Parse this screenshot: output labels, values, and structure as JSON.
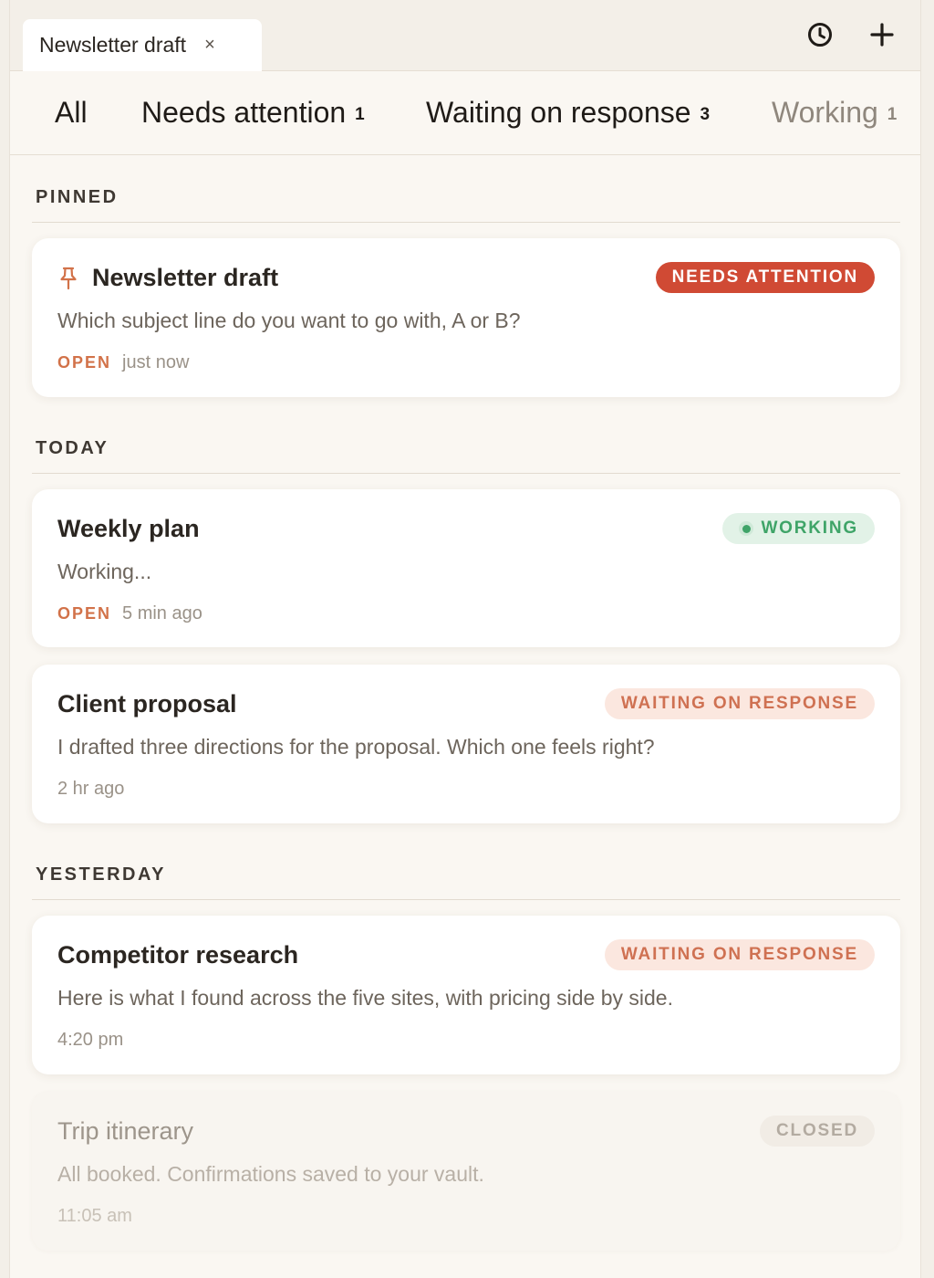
{
  "tab": {
    "title": "Newsletter draft",
    "close": "×"
  },
  "toolbar": {
    "history_icon": "clock-icon",
    "new_icon": "plus-icon"
  },
  "filters": [
    {
      "label": "All",
      "count": ""
    },
    {
      "label": "Needs attention",
      "count": "1"
    },
    {
      "label": "Waiting on response",
      "count": "3"
    },
    {
      "label": "Working",
      "count": "1"
    }
  ],
  "sections": {
    "pinned": "PINNED",
    "today": "TODAY",
    "yesterday": "YESTERDAY"
  },
  "cards": [
    {
      "title": "Newsletter draft",
      "icon": "pin-icon",
      "badge": "NEEDS ATTENTION",
      "body": "Which subject line do you want to go with, A or B?",
      "open": "OPEN",
      "time": "just now"
    },
    {
      "title": "Weekly plan",
      "badge": "WORKING",
      "body": "Working...",
      "open": "OPEN",
      "time": "5 min ago"
    },
    {
      "title": "Client proposal",
      "badge": "WAITING ON RESPONSE",
      "body": "I drafted three directions for the proposal. Which one feels right?",
      "time": "2 hr ago"
    },
    {
      "title": "Competitor research",
      "badge": "WAITING ON RESPONSE",
      "body": "Here is what I found across the five sites, with pricing side by side.",
      "time": "4:20 pm"
    },
    {
      "title": "Trip itinerary",
      "badge": "CLOSED",
      "body": "All booked. Confirmations saved to your vault.",
      "time": "11:05 am"
    }
  ],
  "colors": {
    "attention": "#d04a34",
    "working": "#3fa468",
    "waiting": "#cf7152",
    "open_label": "#d27249"
  }
}
